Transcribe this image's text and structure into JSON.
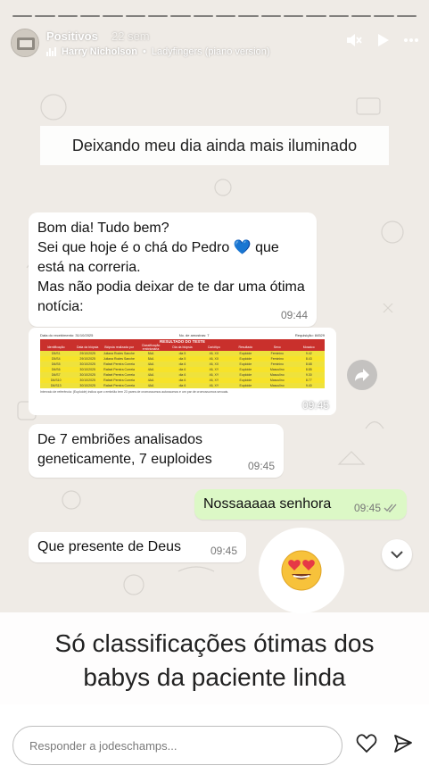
{
  "story": {
    "progress_segments": 18,
    "user": {
      "name": "Positivos",
      "time_ago": "22 sem"
    },
    "music": {
      "artist": "Harry Nicholson",
      "track": "Ladyfingers (piano version)"
    },
    "icons": [
      "mute-icon",
      "play-icon",
      "more-options-icon"
    ]
  },
  "caption_top": "Deixando meu dia ainda mais iluminado",
  "chat": {
    "msg1": {
      "text": "Bom dia! Tudo bem?\nSei que hoje é o chá do Pedro 💙 que está na correria.\nMas não podia deixar de te dar uma ótima notícia:",
      "time": "09:44"
    },
    "image": {
      "time": "09:45",
      "header_left": "Data do recebimento: 31/10/2025",
      "header_mid": "No. de amostras: 7",
      "header_right": "Requisição: 84529",
      "title": "RESULTADO DO TESTE",
      "columns": [
        "Identificação",
        "Data da biópsia",
        "Biópsia realizada por",
        "Classificação embrionária",
        "Dia da biópsia",
        "Cariótipo",
        "Resultado",
        "Sexo",
        "Mosaico"
      ],
      "rows": [
        [
          "D5/S1",
          "29/10/2025",
          "Juliana Rodes Sanches",
          "5AA",
          "dia 5",
          "46, XX",
          "Euploide",
          "Feminino",
          "9.42"
        ],
        [
          "D5/S4",
          "29/10/2025",
          "Juliana Rodes Sanches",
          "5AA",
          "dia 5",
          "46, XX",
          "Euploide",
          "Feminino",
          "8.43"
        ],
        [
          "D6/S5",
          "30/10/2025",
          "Rafael Pereira Correia",
          "4AA",
          "dia 6",
          "46, XX",
          "Euploide",
          "Feminino",
          "8.68"
        ],
        [
          "D6/S6",
          "30/10/2025",
          "Rafael Pereira Correia",
          "4AA",
          "dia 6",
          "46, XY",
          "Euploide",
          "Masculino",
          "8.85"
        ],
        [
          "D6/S7",
          "30/10/2025",
          "Rafael Pereira Correia",
          "4AA",
          "dia 6",
          "46, XY",
          "Euploide",
          "Masculino",
          "9.30"
        ],
        [
          "D6/S10",
          "30/10/2025",
          "Rafael Pereira Correia",
          "4AA",
          "dia 6",
          "46, XY",
          "Euploide",
          "Masculino",
          "8.77"
        ],
        [
          "D6/S13",
          "30/10/2025",
          "Rafael Pereira Correia",
          "4AA",
          "dia 6",
          "46, XY",
          "Euploide",
          "Masculino",
          "9.40"
        ]
      ],
      "footnote": "Intervalo de referência: (Euploide) indica que o embrião tem 23 pares de cromossomos autossomos e um par de cromossomos sexuais."
    },
    "msg2": {
      "text": "De 7 embriões analisados geneticamente, 7 euploides",
      "time": "09:45"
    },
    "msg3": {
      "text": "Nossaaaaa senhora",
      "time": "09:45"
    },
    "msg4": {
      "text": "Que presente de Deus",
      "time": "09:45"
    },
    "reaction": "😍"
  },
  "caption_bottom": "Só classificações ótimas dos\nbabys da paciente linda",
  "footer": {
    "reply_placeholder": "Responder a jodeschamps..."
  },
  "colors": {
    "outgoing_bubble": "#dcf8c6",
    "table_header": "#c9302c",
    "table_row": "#f7e32a"
  }
}
